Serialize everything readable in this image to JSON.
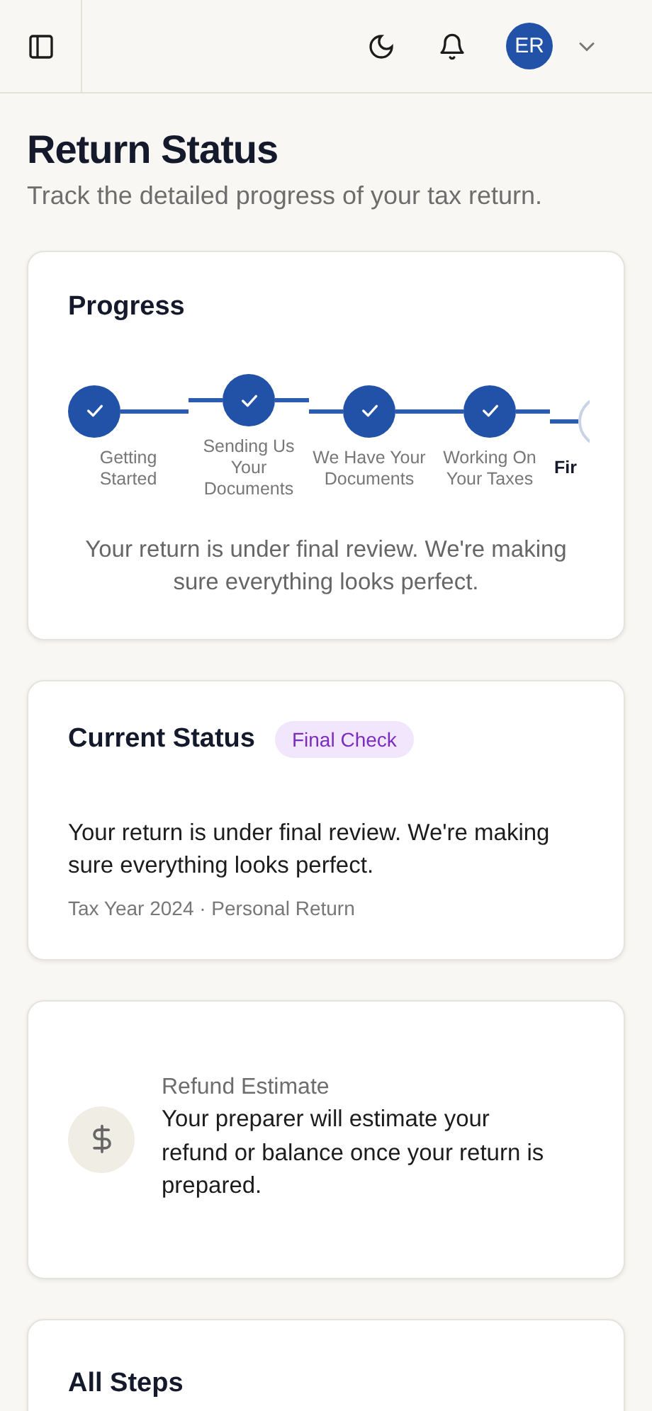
{
  "header": {
    "avatar": "ER"
  },
  "page": {
    "title": "Return Status",
    "subtitle": "Track the detailed progress of your tax return."
  },
  "progress": {
    "title": "Progress",
    "steps": [
      {
        "label": "Getting Started",
        "completed": true
      },
      {
        "label": "Sending Us Your Documents",
        "completed": true
      },
      {
        "label": "We Have Your Documents",
        "completed": true
      },
      {
        "label": "Working On Your Taxes",
        "completed": true
      },
      {
        "label": "Fir",
        "completed": false
      }
    ],
    "message": "Your return is under final review. We're making sure everything looks perfect."
  },
  "current_status": {
    "title": "Current Status",
    "badge": "Final Check",
    "message": "Your return is under final review. We're making sure everything looks perfect.",
    "meta": "Tax Year 2024 · Personal Return"
  },
  "refund": {
    "label": "Refund Estimate",
    "message": "Your preparer will estimate your refund or balance once your return is prepared."
  },
  "all_steps": {
    "title": "All Steps"
  }
}
